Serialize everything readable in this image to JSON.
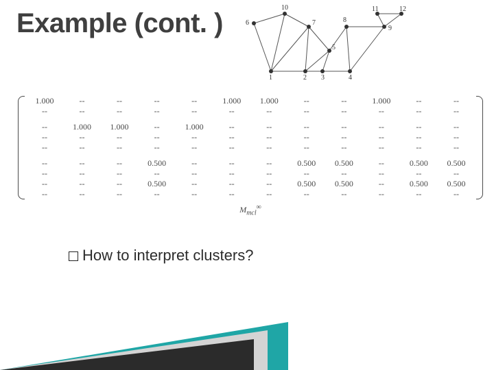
{
  "title": "Example (cont. )",
  "bullet": {
    "prefix": "How",
    "rest": " to interpret clusters?"
  },
  "matrix_label": "M",
  "matrix_sub": "mcl",
  "matrix_sup": "∞",
  "graph": {
    "node_labels": [
      "1",
      "2",
      "3",
      "4",
      "5",
      "6",
      "7",
      "8",
      "9",
      "10",
      "11",
      "12"
    ]
  },
  "matrix": {
    "dash": "--",
    "rows": [
      [
        "1.000",
        "--",
        "--",
        "--",
        "--",
        "1.000",
        "1.000",
        "--",
        "--",
        "1.000",
        "--",
        "--"
      ],
      [
        "--",
        "--",
        "--",
        "--",
        "--",
        "--",
        "--",
        "--",
        "--",
        "--",
        "--",
        "--"
      ],
      null,
      [
        "--",
        "1.000",
        "1.000",
        "--",
        "1.000",
        "--",
        "--",
        "--",
        "--",
        "--",
        "--",
        "--"
      ],
      [
        "--",
        "--",
        "--",
        "--",
        "--",
        "--",
        "--",
        "--",
        "--",
        "--",
        "--",
        "--"
      ],
      [
        "--",
        "--",
        "--",
        "--",
        "--",
        "--",
        "--",
        "--",
        "--",
        "--",
        "--",
        "--"
      ],
      null,
      [
        "--",
        "--",
        "--",
        "0.500",
        "--",
        "--",
        "--",
        "0.500",
        "0.500",
        "--",
        "0.500",
        "0.500"
      ],
      [
        "--",
        "--",
        "--",
        "--",
        "--",
        "--",
        "--",
        "--",
        "--",
        "--",
        "--",
        "--"
      ],
      [
        "--",
        "--",
        "--",
        "0.500",
        "--",
        "--",
        "--",
        "0.500",
        "0.500",
        "--",
        "0.500",
        "0.500"
      ],
      [
        "--",
        "--",
        "--",
        "--",
        "--",
        "--",
        "--",
        "--",
        "--",
        "--",
        "--",
        "--"
      ]
    ]
  }
}
